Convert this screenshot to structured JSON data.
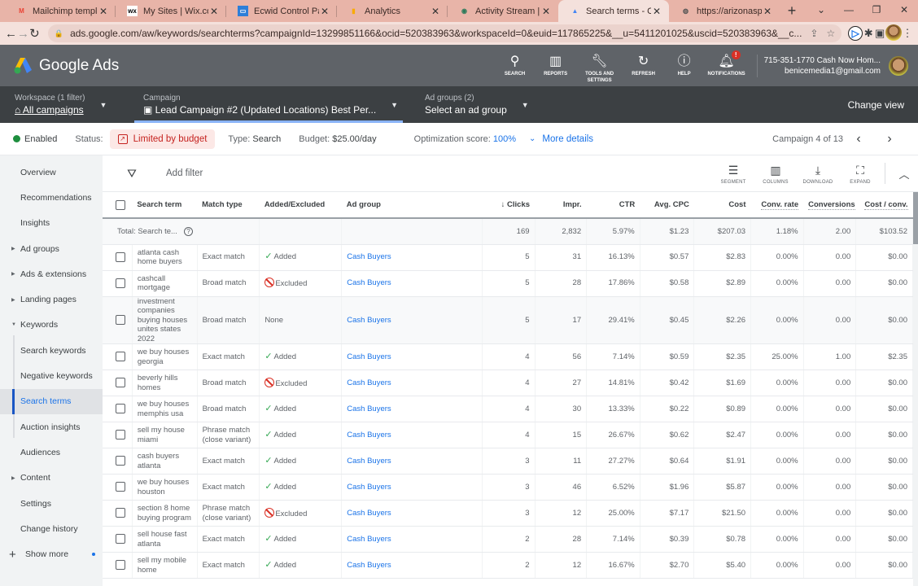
{
  "browser": {
    "tabs": [
      {
        "title": "Mailchimp templat",
        "icon": "gmail-icon",
        "active": false
      },
      {
        "title": "My Sites | Wix.com",
        "icon": "wix-icon",
        "active": false
      },
      {
        "title": "Ecwid Control Pan",
        "icon": "ecwid-icon",
        "active": false
      },
      {
        "title": "Analytics",
        "icon": "analytics-icon",
        "active": false
      },
      {
        "title": "Activity Stream | C",
        "icon": "activity-icon",
        "active": false
      },
      {
        "title": "Search terms - Cas",
        "icon": "google-ads-icon",
        "active": true
      },
      {
        "title": "https://arizonaspo",
        "icon": "globe-icon",
        "active": false
      }
    ],
    "url": "ads.google.com/aw/keywords/searchterms?campaignId=13299851166&ocid=520383963&workspaceId=0&euid=117865225&__u=5411201025&uscid=520383963&__c..."
  },
  "header": {
    "app_name": "Google Ads",
    "icons": [
      {
        "label": "SEARCH",
        "icon": "search-icon"
      },
      {
        "label": "REPORTS",
        "icon": "reports-icon"
      },
      {
        "label": "TOOLS AND SETTINGS",
        "icon": "wrench-icon"
      },
      {
        "label": "REFRESH",
        "icon": "refresh-icon"
      },
      {
        "label": "HELP",
        "icon": "help-icon"
      },
      {
        "label": "NOTIFICATIONS",
        "icon": "bell-icon",
        "badge": "!"
      }
    ],
    "account_name": "715-351-1770 Cash Now Hom...",
    "account_email": "benicemedia1@gmail.com"
  },
  "breadcrumb": {
    "workspace_label": "Workspace (1 filter)",
    "workspace_value": "All campaigns",
    "campaign_label": "Campaign",
    "campaign_value": "Lead Campaign #2 (Updated Locations) Best Per...",
    "adgroup_label": "Ad groups (2)",
    "adgroup_value": "Select an ad group",
    "change_view": "Change view"
  },
  "status": {
    "enabled": "Enabled",
    "status_label": "Status:",
    "status_value": "Limited by budget",
    "type_label": "Type:",
    "type_value": "Search",
    "budget_label": "Budget:",
    "budget_value": "$25.00/day",
    "opt_label": "Optimization score:",
    "opt_value": "100%",
    "more_details": "More details",
    "pager": "Campaign 4 of 13",
    "colors": {
      "accent": "#1a73e8",
      "limited": "#c5221f",
      "enabled": "#1e8e3e"
    }
  },
  "sidebar": {
    "items": [
      {
        "label": "Overview",
        "arrow": ""
      },
      {
        "label": "Recommendations",
        "arrow": ""
      },
      {
        "label": "Insights",
        "arrow": ""
      },
      {
        "label": "Ad groups",
        "arrow": "right"
      },
      {
        "label": "Ads & extensions",
        "arrow": "right"
      },
      {
        "label": "Landing pages",
        "arrow": "right"
      },
      {
        "label": "Keywords",
        "arrow": "down"
      },
      {
        "label": "Search keywords",
        "arrow": "",
        "sub": true
      },
      {
        "label": "Negative keywords",
        "arrow": "",
        "sub": true
      },
      {
        "label": "Search terms",
        "arrow": "",
        "sub": true,
        "active": true
      },
      {
        "label": "Auction insights",
        "arrow": "",
        "sub": true
      },
      {
        "label": "Audiences",
        "arrow": ""
      },
      {
        "label": "Content",
        "arrow": "right"
      },
      {
        "label": "Settings",
        "arrow": ""
      },
      {
        "label": "Change history",
        "arrow": ""
      }
    ],
    "show_more": "Show more"
  },
  "toolbar": {
    "add_filter": "Add filter",
    "buttons": [
      {
        "label": "SEGMENT",
        "icon": "segment-icon"
      },
      {
        "label": "COLUMNS",
        "icon": "columns-icon"
      },
      {
        "label": "DOWNLOAD",
        "icon": "download-icon"
      },
      {
        "label": "EXPAND",
        "icon": "expand-icon"
      }
    ]
  },
  "table": {
    "columns": [
      "Search term",
      "Match type",
      "Added/Excluded",
      "Ad group",
      "Clicks",
      "Impr.",
      "CTR",
      "Avg. CPC",
      "Cost",
      "Conv. rate",
      "Conversions",
      "Cost / conv."
    ],
    "sort_column": "Clicks",
    "total": {
      "label": "Total: Search te...",
      "clicks": "169",
      "impr": "2,832",
      "ctr": "5.97%",
      "cpc": "$1.23",
      "cost": "$207.03",
      "conv_rate": "1.18%",
      "conversions": "2.00",
      "cost_conv": "$103.52"
    },
    "rows": [
      {
        "term": "atlanta cash home buyers",
        "match": "Exact match",
        "status": "Added",
        "adgroup": "Cash Buyers",
        "clicks": "5",
        "impr": "31",
        "ctr": "16.13%",
        "cpc": "$0.57",
        "cost": "$2.83",
        "conv_rate": "0.00%",
        "conversions": "0.00",
        "cost_conv": "$0.00"
      },
      {
        "term": "cashcall mortgage",
        "match": "Broad match",
        "status": "Excluded",
        "adgroup": "Cash Buyers",
        "clicks": "5",
        "impr": "28",
        "ctr": "17.86%",
        "cpc": "$0.58",
        "cost": "$2.89",
        "conv_rate": "0.00%",
        "conversions": "0.00",
        "cost_conv": "$0.00"
      },
      {
        "term": "investment companies buying houses unites states 2022",
        "match": "Broad match",
        "status": "None",
        "adgroup": "Cash Buyers",
        "clicks": "5",
        "impr": "17",
        "ctr": "29.41%",
        "cpc": "$0.45",
        "cost": "$2.26",
        "conv_rate": "0.00%",
        "conversions": "0.00",
        "cost_conv": "$0.00"
      },
      {
        "term": "we buy houses georgia",
        "match": "Exact match",
        "status": "Added",
        "adgroup": "Cash Buyers",
        "clicks": "4",
        "impr": "56",
        "ctr": "7.14%",
        "cpc": "$0.59",
        "cost": "$2.35",
        "conv_rate": "25.00%",
        "conversions": "1.00",
        "cost_conv": "$2.35"
      },
      {
        "term": "beverly hills homes",
        "match": "Broad match",
        "status": "Excluded",
        "adgroup": "Cash Buyers",
        "clicks": "4",
        "impr": "27",
        "ctr": "14.81%",
        "cpc": "$0.42",
        "cost": "$1.69",
        "conv_rate": "0.00%",
        "conversions": "0.00",
        "cost_conv": "$0.00"
      },
      {
        "term": "we buy houses memphis usa",
        "match": "Broad match",
        "status": "Added",
        "adgroup": "Cash Buyers",
        "clicks": "4",
        "impr": "30",
        "ctr": "13.33%",
        "cpc": "$0.22",
        "cost": "$0.89",
        "conv_rate": "0.00%",
        "conversions": "0.00",
        "cost_conv": "$0.00"
      },
      {
        "term": "sell my house miami",
        "match": "Phrase match (close variant)",
        "status": "Added",
        "adgroup": "Cash Buyers",
        "clicks": "4",
        "impr": "15",
        "ctr": "26.67%",
        "cpc": "$0.62",
        "cost": "$2.47",
        "conv_rate": "0.00%",
        "conversions": "0.00",
        "cost_conv": "$0.00"
      },
      {
        "term": "cash buyers atlanta",
        "match": "Exact match",
        "status": "Added",
        "adgroup": "Cash Buyers",
        "clicks": "3",
        "impr": "11",
        "ctr": "27.27%",
        "cpc": "$0.64",
        "cost": "$1.91",
        "conv_rate": "0.00%",
        "conversions": "0.00",
        "cost_conv": "$0.00"
      },
      {
        "term": "we buy houses houston",
        "match": "Exact match",
        "status": "Added",
        "adgroup": "Cash Buyers",
        "clicks": "3",
        "impr": "46",
        "ctr": "6.52%",
        "cpc": "$1.96",
        "cost": "$5.87",
        "conv_rate": "0.00%",
        "conversions": "0.00",
        "cost_conv": "$0.00"
      },
      {
        "term": "section 8 home buying program",
        "match": "Phrase match (close variant)",
        "status": "Excluded",
        "adgroup": "Cash Buyers",
        "clicks": "3",
        "impr": "12",
        "ctr": "25.00%",
        "cpc": "$7.17",
        "cost": "$21.50",
        "conv_rate": "0.00%",
        "conversions": "0.00",
        "cost_conv": "$0.00"
      },
      {
        "term": "sell house fast atlanta",
        "match": "Exact match",
        "status": "Added",
        "adgroup": "Cash Buyers",
        "clicks": "2",
        "impr": "28",
        "ctr": "7.14%",
        "cpc": "$0.39",
        "cost": "$0.78",
        "conv_rate": "0.00%",
        "conversions": "0.00",
        "cost_conv": "$0.00"
      },
      {
        "term": "sell my mobile home",
        "match": "Exact match",
        "status": "Added",
        "adgroup": "Cash Buyers",
        "clicks": "2",
        "impr": "12",
        "ctr": "16.67%",
        "cpc": "$2.70",
        "cost": "$5.40",
        "conv_rate": "0.00%",
        "conversions": "0.00",
        "cost_conv": "$0.00"
      }
    ]
  }
}
